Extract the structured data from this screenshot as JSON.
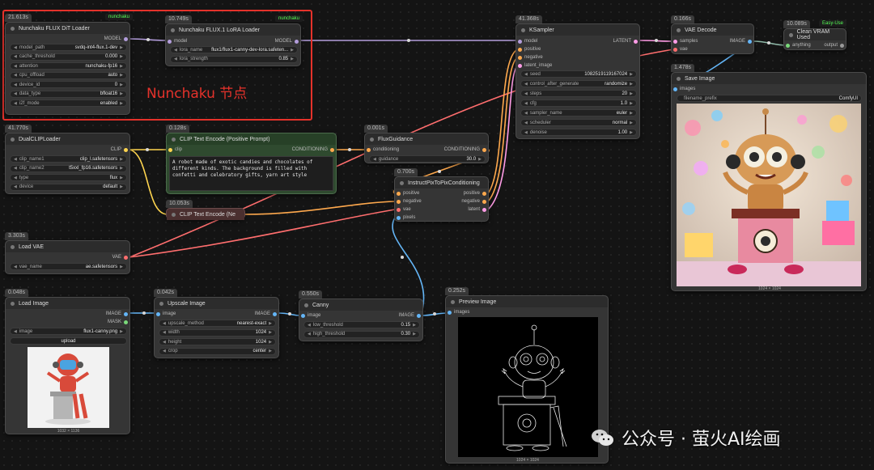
{
  "annotation": {
    "label": "Nunchaku 节点"
  },
  "watermark": {
    "text": "公众号 · 萤火AI绘画",
    "icon": "wechat-icon"
  },
  "nodes": {
    "flux_dit": {
      "timing": "21.613s",
      "badge": "nunchaku",
      "title": "Nunchaku FLUX DiT Loader",
      "out": "MODEL",
      "widgets": [
        [
          "model_path",
          "svdq-int4-flux.1-dev"
        ],
        [
          "cache_threshold",
          "0.000"
        ],
        [
          "attention",
          "nunchaku-fp16"
        ],
        [
          "cpu_offload",
          "auto"
        ],
        [
          "device_id",
          "0"
        ],
        [
          "data_type",
          "bfloat16"
        ],
        [
          "i2f_mode",
          "enabled"
        ]
      ]
    },
    "lora": {
      "timing": "10.749s",
      "badge": "nunchaku",
      "title": "Nunchaku FLUX.1 LoRA Loader",
      "in": "model",
      "out": "MODEL",
      "widgets": [
        [
          "lora_name",
          "flux1/flux1-canny-dev-lora.safeten..."
        ],
        [
          "lora_strength",
          "0.85"
        ]
      ]
    },
    "ksampler": {
      "timing": "41.368s",
      "title": "KSampler",
      "inputs": [
        "model",
        "positive",
        "negative",
        "latent_image"
      ],
      "out": "LATENT",
      "widgets": [
        [
          "seed",
          "1082519119167024"
        ],
        [
          "control_after_generate",
          "randomize"
        ],
        [
          "steps",
          "20"
        ],
        [
          "cfg",
          "1.0"
        ],
        [
          "sampler_name",
          "euler"
        ],
        [
          "scheduler",
          "normal"
        ],
        [
          "denoise",
          "1.00"
        ]
      ]
    },
    "vae_decode": {
      "timing": "0.166s",
      "title": "VAE Decode",
      "inputs": [
        "samples",
        "vae"
      ],
      "out": "IMAGE"
    },
    "clean_vram": {
      "timing": "10.089s",
      "badge": "Easy-Use",
      "title": "Clean VRAM Used",
      "in": "anything",
      "out": "output"
    },
    "save_image": {
      "timing": "1.478s",
      "title": "Save Image",
      "in": "images",
      "widget": [
        "filename_prefix",
        "ComfyUI"
      ],
      "caption": "1024 × 1024"
    },
    "dual_clip": {
      "timing": "41.770s",
      "title": "DualCLIPLoader",
      "out": "CLIP",
      "widgets": [
        [
          "clip_name1",
          "clip_l.safetensors"
        ],
        [
          "clip_name2",
          "t5xxl_fp16.safetensors"
        ],
        [
          "type",
          "flux"
        ],
        [
          "device",
          "default"
        ]
      ]
    },
    "clip_pos": {
      "timing": "0.128s",
      "title": "CLIP Text Encode (Positive Prompt)",
      "in": "clip",
      "out": "CONDITIONING",
      "text": "A robot made of exotic candies and chocolates of different kinds. The background is filled with confetti and celebratory gifts, yarn art style"
    },
    "clip_neg": {
      "timing": "10.053s",
      "title": "CLIP Text Encode (Ne"
    },
    "flux_guidance": {
      "timing": "0.001s",
      "title": "FluxGuidance",
      "in": "conditioning",
      "out": "CONDITIONING",
      "widget": [
        "guidance",
        "30.0"
      ]
    },
    "instruct": {
      "timing": "0.700s",
      "title": "InstructPixToPixConditioning",
      "inputs": [
        "positive",
        "negative",
        "vae",
        "pixels"
      ],
      "outputs": [
        "positive",
        "negative",
        "latent"
      ]
    },
    "load_vae": {
      "timing": "3.303s",
      "title": "Load VAE",
      "out": "VAE",
      "widget": [
        "vae_name",
        "ae.safetensors"
      ]
    },
    "load_image": {
      "timing": "0.048s",
      "title": "Load Image",
      "outputs": [
        "IMAGE",
        "MASK"
      ],
      "widget": [
        "image",
        "flux1-canny.png"
      ],
      "upload": "upload",
      "caption": "1032 × 1136"
    },
    "upscale": {
      "timing": "0.042s",
      "title": "Upscale Image",
      "in": "image",
      "out": "IMAGE",
      "widgets": [
        [
          "upscale_method",
          "nearest-exact"
        ],
        [
          "width",
          "1024"
        ],
        [
          "height",
          "1024"
        ],
        [
          "crop",
          "center"
        ]
      ]
    },
    "canny": {
      "timing": "0.550s",
      "title": "Canny",
      "in": "image",
      "out": "IMAGE",
      "widgets": [
        [
          "low_threshold",
          "0.15"
        ],
        [
          "high_threshold",
          "0.30"
        ]
      ]
    },
    "preview": {
      "timing": "0.252s",
      "title": "Preview Image",
      "in": "images",
      "caption": "1024 × 1024"
    }
  },
  "colors": {
    "model": "#b39ddb",
    "clip": "#ffd54f",
    "conditioning": "#ffa94d",
    "vae": "#ff6e6e",
    "image": "#64b5f6",
    "latent": "#ff9ce6",
    "mask": "#7ad97a"
  }
}
